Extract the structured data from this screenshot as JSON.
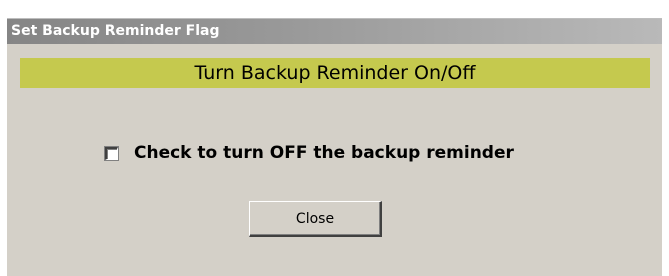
{
  "window": {
    "title": "Set Backup Reminder Flag"
  },
  "header": {
    "title": "Turn Backup Reminder On/Off",
    "band_color": "#c5c94e"
  },
  "reminder_checkbox": {
    "label": "Check to turn OFF the backup reminder",
    "checked": false
  },
  "actions": {
    "close_label": "Close"
  }
}
